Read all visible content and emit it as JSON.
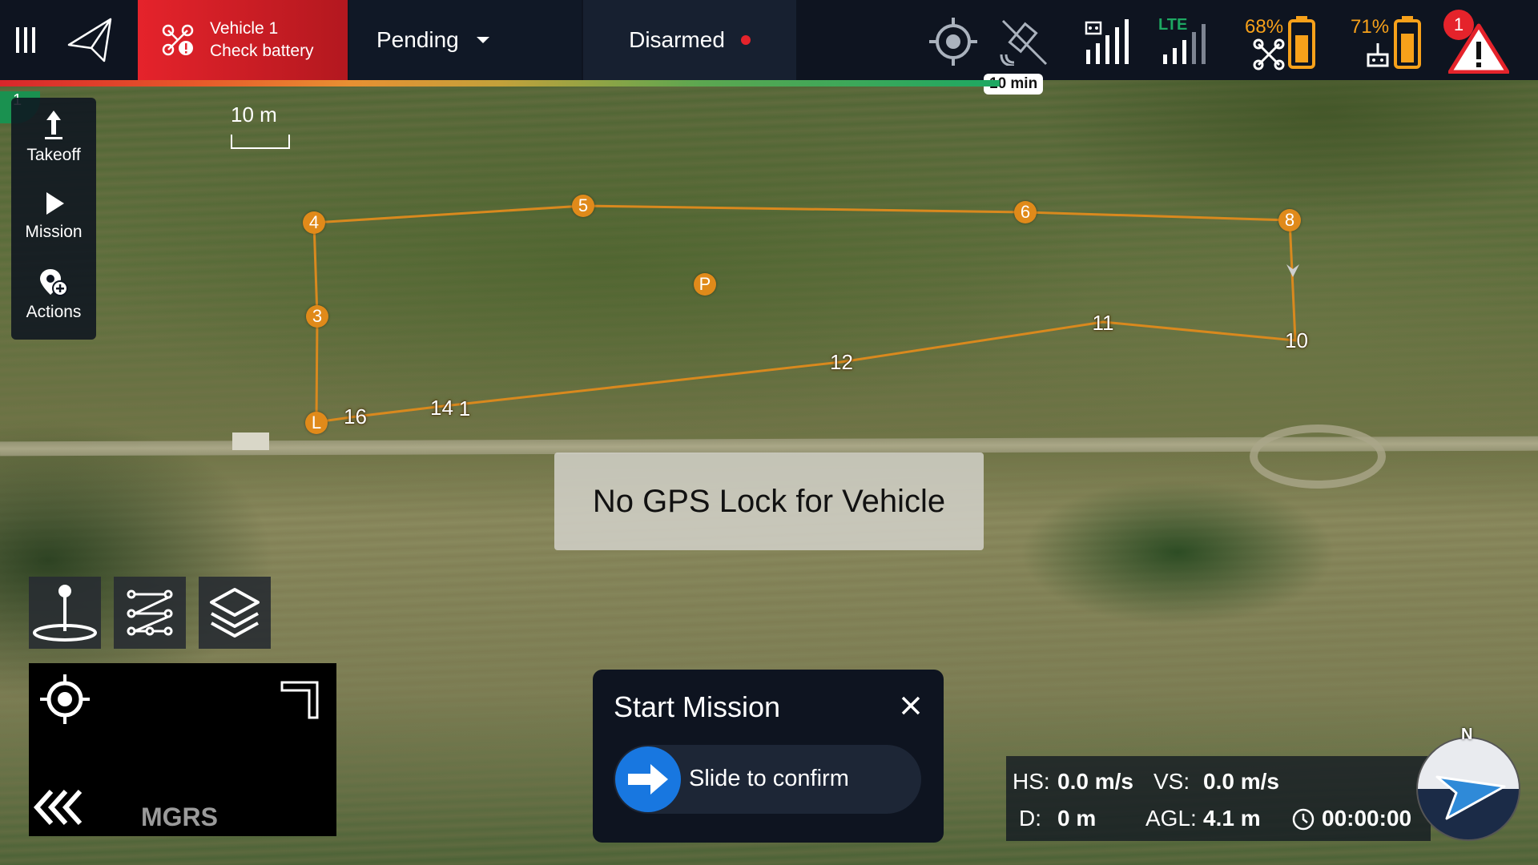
{
  "topbar": {
    "vehicle_name": "Vehicle 1",
    "vehicle_status": "Check battery",
    "flight_mode": "Pending",
    "arm_state": "Disarmed",
    "flight_time_remaining": "10 min",
    "signal_lte_label": "LTE",
    "vehicle_battery_pct": "68%",
    "controller_battery_pct": "71%",
    "alerts_count": "1",
    "battery_progress_fraction": 0.65,
    "colors": {
      "alert": "#e5232b",
      "battery": "#f7a11a",
      "accent": "#1877e0",
      "link": "#1da862"
    }
  },
  "left_toolbar": {
    "vehicle_index": "1",
    "takeoff_label": "Takeoff",
    "mission_label": "Mission",
    "actions_label": "Actions"
  },
  "map": {
    "scale_label": "10 m",
    "waypoints": [
      "3",
      "4",
      "5",
      "6",
      "8",
      "10",
      "11",
      "12",
      "14",
      "1",
      "16",
      "L",
      "P"
    ],
    "toast": "No GPS Lock for Vehicle"
  },
  "bottom_left": {
    "buttons": [
      "takeoff-location-icon",
      "route-icon",
      "layers-icon"
    ],
    "minimap_label": "MGRS"
  },
  "start_mission": {
    "title": "Start Mission",
    "slider_label": "Slide to confirm"
  },
  "telemetry": {
    "hs_label": "HS:",
    "hs_value": "0.0 m/s",
    "vs_label": "VS:",
    "vs_value": "0.0 m/s",
    "d_label": "D:",
    "d_value": "0 m",
    "agl_label": "AGL:",
    "agl_value": "4.1 m",
    "timer_value": "00:00:00"
  },
  "compass": {
    "north_label": "N"
  }
}
